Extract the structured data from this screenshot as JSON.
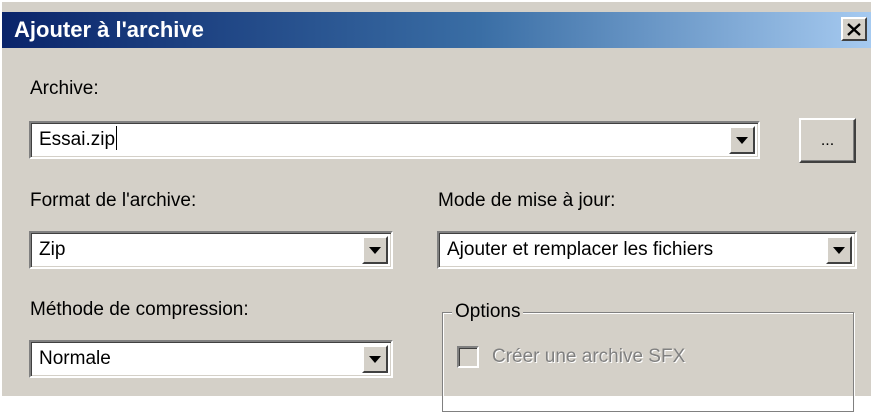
{
  "dialog": {
    "title": "Ajouter à l'archive",
    "close_glyph": "✕"
  },
  "archive": {
    "label": "Archive:",
    "value": "Essai.zip",
    "browse_label": "..."
  },
  "format": {
    "label": "Format de l'archive:",
    "value": "Zip"
  },
  "update_mode": {
    "label": "Mode de mise à jour:",
    "value": "Ajouter et remplacer les fichiers"
  },
  "compression": {
    "label": "Méthode de compression:",
    "value": "Normale"
  },
  "options": {
    "legend": "Options",
    "sfx_label": "Créer une archive SFX",
    "sfx_checked": false,
    "sfx_enabled": false
  },
  "colors": {
    "title_gradient_start": "#0a246a",
    "title_gradient_end": "#a6caf0",
    "face": "#d4d0c8"
  },
  "icons": {
    "dropdown": "chevron-down-icon",
    "close": "close-icon"
  }
}
